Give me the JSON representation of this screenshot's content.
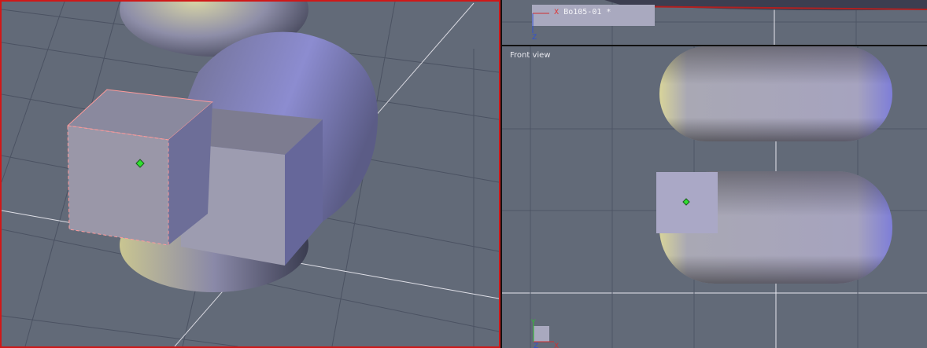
{
  "window": {
    "accent_color": "#d01818"
  },
  "viewports": {
    "perspective": {
      "label": ""
    },
    "top": {
      "object_name": "Bo105-01 *"
    },
    "front": {
      "label": "Front view"
    }
  },
  "axes": {
    "x": "X",
    "y": "Y",
    "z": "Z"
  },
  "icons": {
    "pivot": "pivot-icon",
    "gizmo": "axis-gizmo-icon"
  }
}
